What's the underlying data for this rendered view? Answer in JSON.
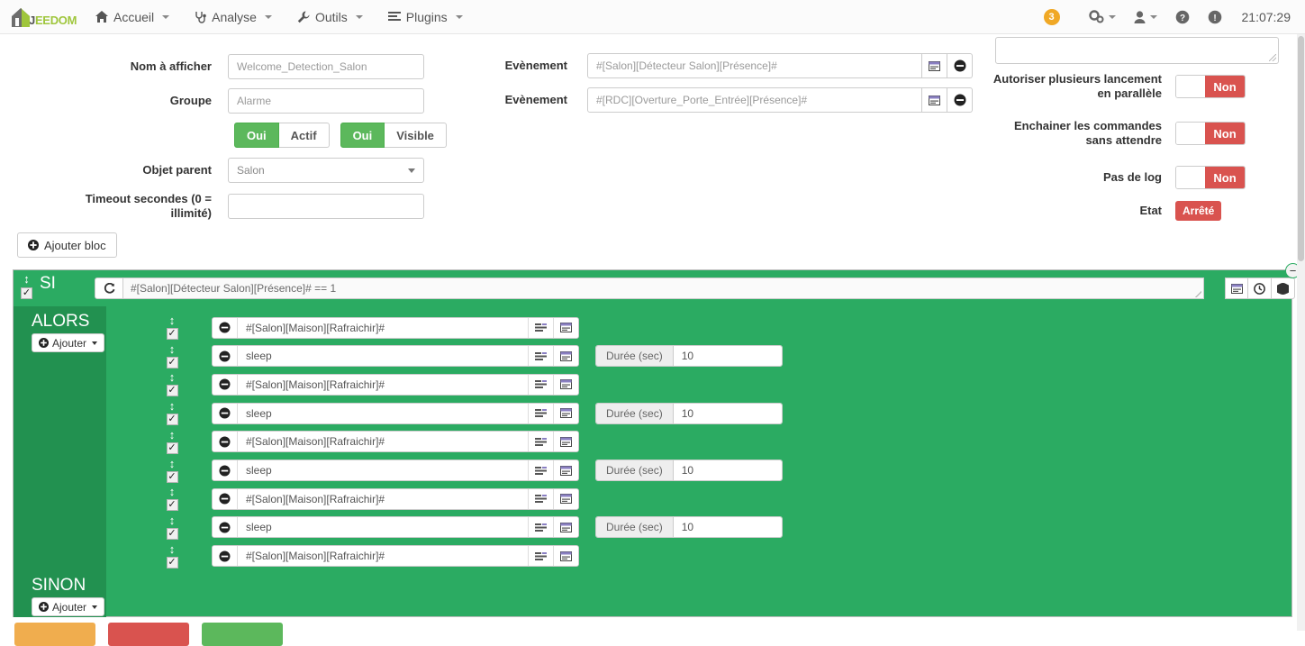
{
  "nav": {
    "logo": {
      "text_1": "J",
      "text_2": "EE",
      "text_3": "DOM"
    },
    "items": [
      {
        "label": "Accueil",
        "icon": "home-icon"
      },
      {
        "label": "Analyse",
        "icon": "stethoscope-icon"
      },
      {
        "label": "Outils",
        "icon": "wrench-icon"
      },
      {
        "label": "Plugins",
        "icon": "list-icon"
      }
    ],
    "badge_count": "3",
    "right_icons": [
      "gears-icon",
      "user-icon",
      "help-icon",
      "info-icon"
    ],
    "clock": "21:07:29",
    "badge_color": "#f0a825"
  },
  "form": {
    "name_label": "Nom à afficher",
    "name_value": "Welcome_Detection_Salon",
    "group_label": "Groupe",
    "group_value": "Alarme",
    "toggles": [
      {
        "on_label": "Oui",
        "off_label": "Actif"
      },
      {
        "on_label": "Oui",
        "off_label": "Visible"
      }
    ],
    "parent_label": "Objet parent",
    "parent_value": "Salon",
    "timeout_label": "Timeout secondes (0 = illimité)",
    "timeout_value": "",
    "events": [
      {
        "label": "Evènement",
        "value": "#[Salon][Détecteur Salon][Présence]#"
      },
      {
        "label": "Evènement",
        "value": "#[RDC][Overture_Porte_Entrée][Présence]#"
      }
    ],
    "event_icons": [
      "window-icon",
      "minus-circle-icon"
    ]
  },
  "right_panel": {
    "description_value": "",
    "options": [
      {
        "label": "Autoriser plusieurs lancement en parallèle",
        "value": "Non"
      },
      {
        "label": "Enchainer les commandes sans attendre",
        "value": "Non"
      },
      {
        "label": "Pas de log",
        "value": "Non"
      }
    ],
    "state_label": "Etat",
    "state_value": "Arrêté",
    "state_color": "#d9534f"
  },
  "add_block_button": "Ajouter bloc",
  "rule": {
    "si": {
      "title": "SI",
      "condition": "#[Salon][Détecteur Salon][Présence]# == 1",
      "refresh_icon": "refresh-icon",
      "icons": [
        "window-icon",
        "history-icon",
        "globe-icon"
      ],
      "remove_icon": "minus-circle-icon"
    },
    "alors": {
      "title": "ALORS",
      "add_label": "Ajouter",
      "actions": [
        {
          "command": "#[Salon][Maison][Rafraichir]#",
          "duration_label": null,
          "duration_value": null
        },
        {
          "command": "sleep",
          "duration_label": "Durée (sec)",
          "duration_value": "10"
        },
        {
          "command": "#[Salon][Maison][Rafraichir]#",
          "duration_label": null,
          "duration_value": null
        },
        {
          "command": "sleep",
          "duration_label": "Durée (sec)",
          "duration_value": "10"
        },
        {
          "command": "#[Salon][Maison][Rafraichir]#",
          "duration_label": null,
          "duration_value": null
        },
        {
          "command": "sleep",
          "duration_label": "Durée (sec)",
          "duration_value": "10"
        },
        {
          "command": "#[Salon][Maison][Rafraichir]#",
          "duration_label": null,
          "duration_value": null
        },
        {
          "command": "sleep",
          "duration_label": "Durée (sec)",
          "duration_value": "10"
        },
        {
          "command": "#[Salon][Maison][Rafraichir]#",
          "duration_label": null,
          "duration_value": null
        }
      ]
    },
    "sinon": {
      "title": "SINON",
      "add_label": "Ajouter"
    },
    "block_color": "#2bab62",
    "label_col_color": "#229150"
  },
  "bottom_buttons": [
    {
      "label": "",
      "color": "#f0ad4e"
    },
    {
      "label": "",
      "color": "#d9534f"
    },
    {
      "label": "",
      "color": "#5cb85c"
    }
  ]
}
